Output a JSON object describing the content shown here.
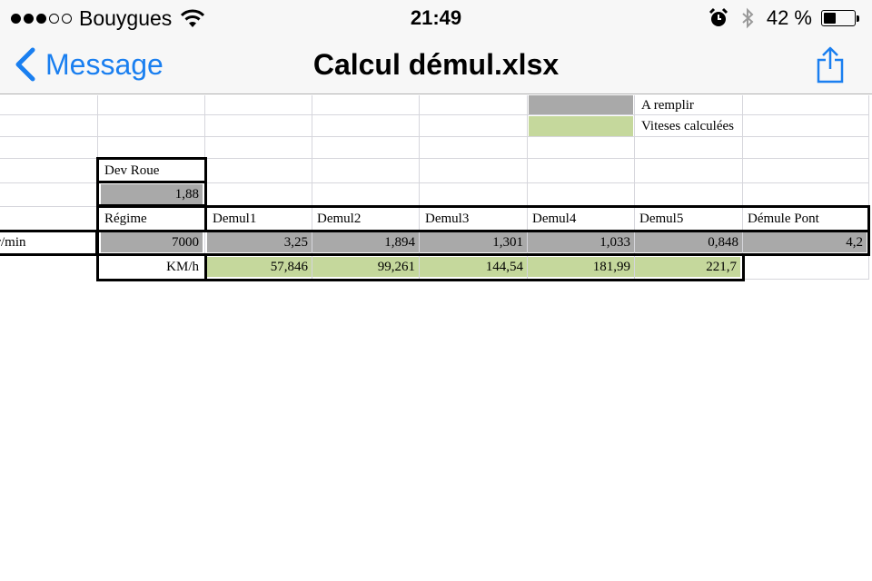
{
  "status_bar": {
    "carrier": "Bouygues",
    "time": "21:49",
    "battery_percent": "42 %",
    "battery_level": 0.42,
    "signal_bars_filled": 3,
    "signal_bars_total": 5,
    "icons": [
      "wifi-icon",
      "alarm-icon",
      "bluetooth-icon",
      "battery-icon"
    ]
  },
  "nav": {
    "back_label": "Message",
    "title": "Calcul démul.xlsx",
    "accent_color": "#1a7ff0",
    "share_icon": "share-icon"
  },
  "sheet": {
    "legend": {
      "fill_label": "A remplir",
      "computed_label": "Viteses calculées",
      "fill_color": "#a9a9a9",
      "computed_color": "#c5d89c"
    },
    "dev_roue": {
      "label": "Dev Roue",
      "value": "1,88"
    },
    "headers": {
      "regime": "Régime",
      "demul1": "Demul1",
      "demul2": "Demul2",
      "demul3": "Demul3",
      "demul4": "Demul4",
      "demul5": "Demul5",
      "demule_pont": "Démule Pont"
    },
    "rpm_row": {
      "unit": "r/min",
      "regime": "7000",
      "demul1": "3,25",
      "demul2": "1,894",
      "demul3": "1,301",
      "demul4": "1,033",
      "demul5": "0,848",
      "demule_pont": "4,2"
    },
    "speed_row": {
      "unit": "KM/h",
      "demul1": "57,846",
      "demul2": "99,261",
      "demul3": "144,54",
      "demul4": "181,99",
      "demul5": "221,7"
    }
  }
}
